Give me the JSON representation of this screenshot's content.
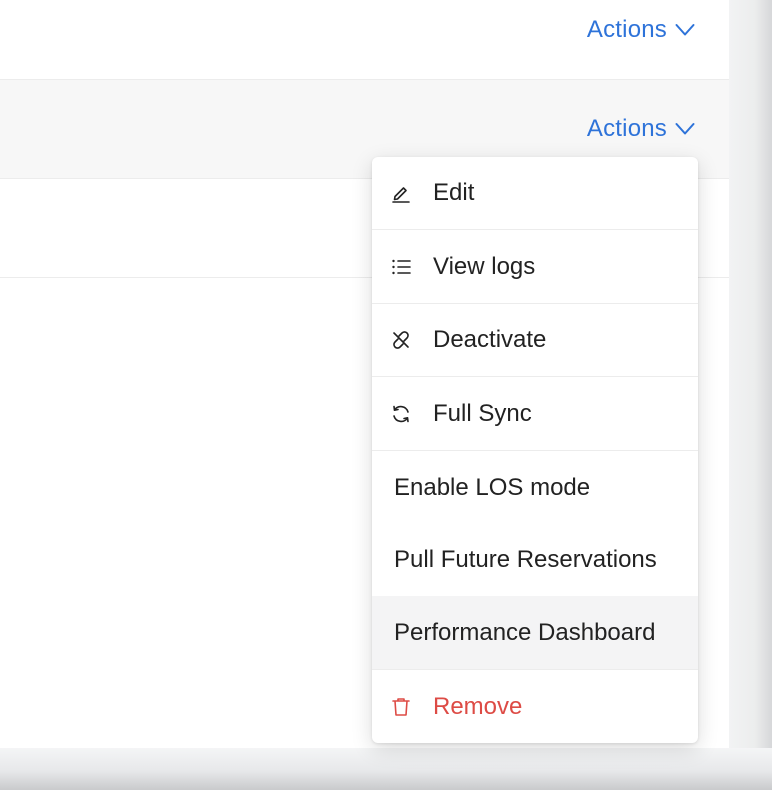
{
  "rows": [
    {
      "actions_label": "Actions"
    },
    {
      "actions_label": "Actions"
    }
  ],
  "menu": {
    "items": [
      {
        "label": "Edit",
        "icon": "pencil-icon"
      },
      {
        "label": "View logs",
        "icon": "list-icon"
      },
      {
        "label": "Deactivate",
        "icon": "unlink-icon"
      },
      {
        "label": "Full Sync",
        "icon": "sync-icon"
      },
      {
        "label": "Enable LOS mode"
      },
      {
        "label": "Pull Future Reservations"
      },
      {
        "label": "Performance Dashboard",
        "highlighted": true
      },
      {
        "label": "Remove",
        "icon": "trash-icon",
        "danger": true
      }
    ]
  },
  "colors": {
    "link": "#2e73d9",
    "danger": "#dd4b45",
    "text": "#222222",
    "highlight": "#f4f4f5"
  }
}
